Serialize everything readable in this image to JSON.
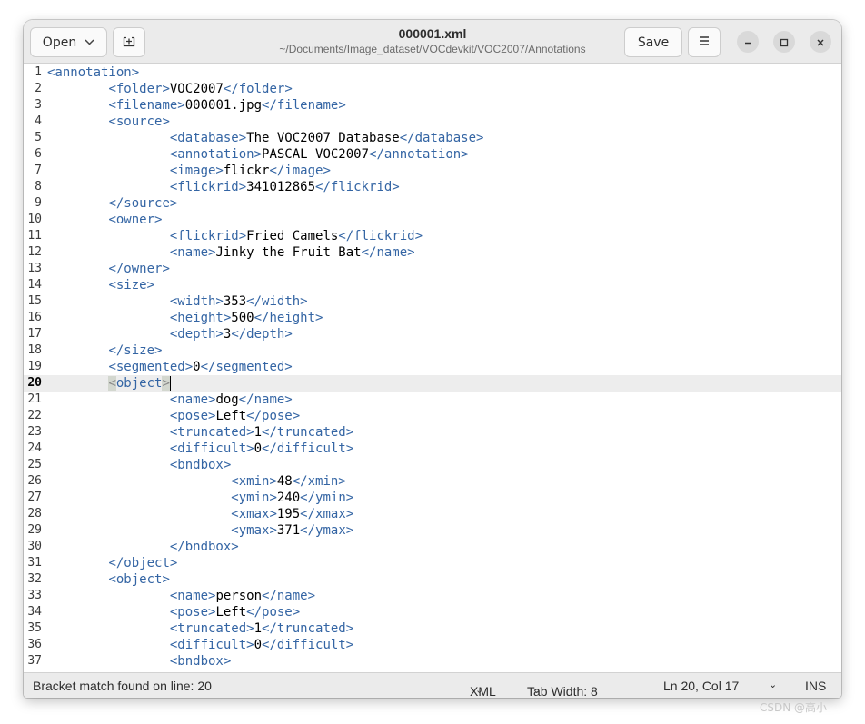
{
  "window": {
    "title": "000001.xml",
    "subtitle": "~/Documents/Image_dataset/VOCdevkit/VOC2007/Annotations"
  },
  "headerbar": {
    "open_label": "Open",
    "new_tab_icon": "new-tab-icon",
    "save_label": "Save",
    "menu_icon": "hamburger-menu-icon",
    "minimize_icon": "minimize-icon",
    "maximize_icon": "maximize-icon",
    "close_icon": "close-icon"
  },
  "editor": {
    "current_line": 20,
    "lines": [
      {
        "n": "1",
        "segs": [
          [
            "tag",
            "<annotation>"
          ]
        ]
      },
      {
        "n": "2",
        "segs": [
          [
            "txt",
            "\t"
          ],
          [
            "tag",
            "<folder>"
          ],
          [
            "txt",
            "VOC2007"
          ],
          [
            "tag",
            "</folder>"
          ]
        ]
      },
      {
        "n": "3",
        "segs": [
          [
            "txt",
            "\t"
          ],
          [
            "tag",
            "<filename>"
          ],
          [
            "txt",
            "000001.jpg"
          ],
          [
            "tag",
            "</filename>"
          ]
        ]
      },
      {
        "n": "4",
        "segs": [
          [
            "txt",
            "\t"
          ],
          [
            "tag",
            "<source>"
          ]
        ]
      },
      {
        "n": "5",
        "segs": [
          [
            "txt",
            "\t\t"
          ],
          [
            "tag",
            "<database>"
          ],
          [
            "txt",
            "The VOC2007 Database"
          ],
          [
            "tag",
            "</database>"
          ]
        ]
      },
      {
        "n": "6",
        "segs": [
          [
            "txt",
            "\t\t"
          ],
          [
            "tag",
            "<annotation>"
          ],
          [
            "txt",
            "PASCAL VOC2007"
          ],
          [
            "tag",
            "</annotation>"
          ]
        ]
      },
      {
        "n": "7",
        "segs": [
          [
            "txt",
            "\t\t"
          ],
          [
            "tag",
            "<image>"
          ],
          [
            "txt",
            "flickr"
          ],
          [
            "tag",
            "</image>"
          ]
        ]
      },
      {
        "n": "8",
        "segs": [
          [
            "txt",
            "\t\t"
          ],
          [
            "tag",
            "<flickrid>"
          ],
          [
            "txt",
            "341012865"
          ],
          [
            "tag",
            "</flickrid>"
          ]
        ]
      },
      {
        "n": "9",
        "segs": [
          [
            "txt",
            "\t"
          ],
          [
            "tag",
            "</source>"
          ]
        ]
      },
      {
        "n": "10",
        "segs": [
          [
            "txt",
            "\t"
          ],
          [
            "tag",
            "<owner>"
          ]
        ]
      },
      {
        "n": "11",
        "segs": [
          [
            "txt",
            "\t\t"
          ],
          [
            "tag",
            "<flickrid>"
          ],
          [
            "txt",
            "Fried Camels"
          ],
          [
            "tag",
            "</flickrid>"
          ]
        ]
      },
      {
        "n": "12",
        "segs": [
          [
            "txt",
            "\t\t"
          ],
          [
            "tag",
            "<name>"
          ],
          [
            "txt",
            "Jinky the Fruit Bat"
          ],
          [
            "tag",
            "</name>"
          ]
        ]
      },
      {
        "n": "13",
        "segs": [
          [
            "txt",
            "\t"
          ],
          [
            "tag",
            "</owner>"
          ]
        ]
      },
      {
        "n": "14",
        "segs": [
          [
            "txt",
            "\t"
          ],
          [
            "tag",
            "<size>"
          ]
        ]
      },
      {
        "n": "15",
        "segs": [
          [
            "txt",
            "\t\t"
          ],
          [
            "tag",
            "<width>"
          ],
          [
            "txt",
            "353"
          ],
          [
            "tag",
            "</width>"
          ]
        ]
      },
      {
        "n": "16",
        "segs": [
          [
            "txt",
            "\t\t"
          ],
          [
            "tag",
            "<height>"
          ],
          [
            "txt",
            "500"
          ],
          [
            "tag",
            "</height>"
          ]
        ]
      },
      {
        "n": "17",
        "segs": [
          [
            "txt",
            "\t\t"
          ],
          [
            "tag",
            "<depth>"
          ],
          [
            "txt",
            "3"
          ],
          [
            "tag",
            "</depth>"
          ]
        ]
      },
      {
        "n": "18",
        "segs": [
          [
            "txt",
            "\t"
          ],
          [
            "tag",
            "</size>"
          ]
        ]
      },
      {
        "n": "19",
        "segs": [
          [
            "txt",
            "\t"
          ],
          [
            "tag",
            "<segmented>"
          ],
          [
            "txt",
            "0"
          ],
          [
            "tag",
            "</segmented>"
          ]
        ]
      },
      {
        "n": "20",
        "segs": [
          [
            "txt",
            "\t"
          ],
          [
            "bm",
            "<"
          ],
          [
            "tag",
            "object"
          ],
          [
            "bm",
            ">"
          ]
        ]
      },
      {
        "n": "21",
        "segs": [
          [
            "txt",
            "\t\t"
          ],
          [
            "tag",
            "<name>"
          ],
          [
            "txt",
            "dog"
          ],
          [
            "tag",
            "</name>"
          ]
        ]
      },
      {
        "n": "22",
        "segs": [
          [
            "txt",
            "\t\t"
          ],
          [
            "tag",
            "<pose>"
          ],
          [
            "txt",
            "Left"
          ],
          [
            "tag",
            "</pose>"
          ]
        ]
      },
      {
        "n": "23",
        "segs": [
          [
            "txt",
            "\t\t"
          ],
          [
            "tag",
            "<truncated>"
          ],
          [
            "txt",
            "1"
          ],
          [
            "tag",
            "</truncated>"
          ]
        ]
      },
      {
        "n": "24",
        "segs": [
          [
            "txt",
            "\t\t"
          ],
          [
            "tag",
            "<difficult>"
          ],
          [
            "txt",
            "0"
          ],
          [
            "tag",
            "</difficult>"
          ]
        ]
      },
      {
        "n": "25",
        "segs": [
          [
            "txt",
            "\t\t"
          ],
          [
            "tag",
            "<bndbox>"
          ]
        ]
      },
      {
        "n": "26",
        "segs": [
          [
            "txt",
            "\t\t\t"
          ],
          [
            "tag",
            "<xmin>"
          ],
          [
            "txt",
            "48"
          ],
          [
            "tag",
            "</xmin>"
          ]
        ]
      },
      {
        "n": "27",
        "segs": [
          [
            "txt",
            "\t\t\t"
          ],
          [
            "tag",
            "<ymin>"
          ],
          [
            "txt",
            "240"
          ],
          [
            "tag",
            "</ymin>"
          ]
        ]
      },
      {
        "n": "28",
        "segs": [
          [
            "txt",
            "\t\t\t"
          ],
          [
            "tag",
            "<xmax>"
          ],
          [
            "txt",
            "195"
          ],
          [
            "tag",
            "</xmax>"
          ]
        ]
      },
      {
        "n": "29",
        "segs": [
          [
            "txt",
            "\t\t\t"
          ],
          [
            "tag",
            "<ymax>"
          ],
          [
            "txt",
            "371"
          ],
          [
            "tag",
            "</ymax>"
          ]
        ]
      },
      {
        "n": "30",
        "segs": [
          [
            "txt",
            "\t\t"
          ],
          [
            "tag",
            "</bndbox>"
          ]
        ]
      },
      {
        "n": "31",
        "segs": [
          [
            "txt",
            "\t"
          ],
          [
            "tag",
            "</object>"
          ]
        ]
      },
      {
        "n": "32",
        "segs": [
          [
            "txt",
            "\t"
          ],
          [
            "tag",
            "<object>"
          ]
        ]
      },
      {
        "n": "33",
        "segs": [
          [
            "txt",
            "\t\t"
          ],
          [
            "tag",
            "<name>"
          ],
          [
            "txt",
            "person"
          ],
          [
            "tag",
            "</name>"
          ]
        ]
      },
      {
        "n": "34",
        "segs": [
          [
            "txt",
            "\t\t"
          ],
          [
            "tag",
            "<pose>"
          ],
          [
            "txt",
            "Left"
          ],
          [
            "tag",
            "</pose>"
          ]
        ]
      },
      {
        "n": "35",
        "segs": [
          [
            "txt",
            "\t\t"
          ],
          [
            "tag",
            "<truncated>"
          ],
          [
            "txt",
            "1"
          ],
          [
            "tag",
            "</truncated>"
          ]
        ]
      },
      {
        "n": "36",
        "segs": [
          [
            "txt",
            "\t\t"
          ],
          [
            "tag",
            "<difficult>"
          ],
          [
            "txt",
            "0"
          ],
          [
            "tag",
            "</difficult>"
          ]
        ]
      },
      {
        "n": "37",
        "segs": [
          [
            "txt",
            "\t\t"
          ],
          [
            "tag",
            "<bndbox>"
          ]
        ]
      }
    ]
  },
  "statusbar": {
    "message": "Bracket match found on line: 20",
    "language": "XML",
    "tab_width": "Tab Width: 8",
    "position": "Ln 20, Col 17",
    "mode": "INS"
  },
  "watermark": "CSDN @高小"
}
